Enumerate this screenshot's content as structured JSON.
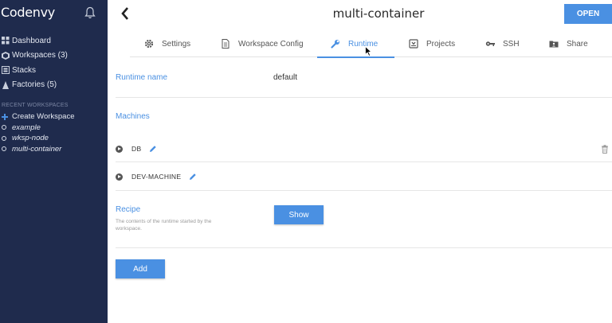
{
  "sidebar": {
    "brand": "Codenvy",
    "nav": [
      {
        "label": "Dashboard",
        "icon": "dashboard-icon"
      },
      {
        "label": "Workspaces (3)",
        "icon": "workspaces-icon"
      },
      {
        "label": "Stacks",
        "icon": "stacks-icon"
      },
      {
        "label": "Factories (5)",
        "icon": "factories-icon"
      }
    ],
    "recent_label": "RECENT WORKSPACES",
    "create_label": "Create Workspace",
    "recent": [
      "example",
      "wksp-node",
      "multi-container"
    ]
  },
  "header": {
    "title": "multi-container",
    "open_label": "OPEN"
  },
  "tabs": [
    {
      "label": "Settings",
      "icon": "gear-icon"
    },
    {
      "label": "Workspace Config",
      "icon": "document-icon"
    },
    {
      "label": "Runtime",
      "icon": "wrench-icon"
    },
    {
      "label": "Projects",
      "icon": "projects-icon"
    },
    {
      "label": "SSH",
      "icon": "key-icon"
    },
    {
      "label": "Share",
      "icon": "share-icon"
    }
  ],
  "active_tab": "Runtime",
  "runtime": {
    "name_label": "Runtime name",
    "name_value": "default",
    "machines_label": "Machines",
    "machines": [
      "DB",
      "DEV-MACHINE"
    ],
    "recipe_label": "Recipe",
    "recipe_desc": "The contents of the runtime started by the workspace.",
    "show_label": "Show",
    "add_label": "Add"
  },
  "colors": {
    "sidebar_bg": "#1f2b4d",
    "accent": "#4a90e2"
  }
}
